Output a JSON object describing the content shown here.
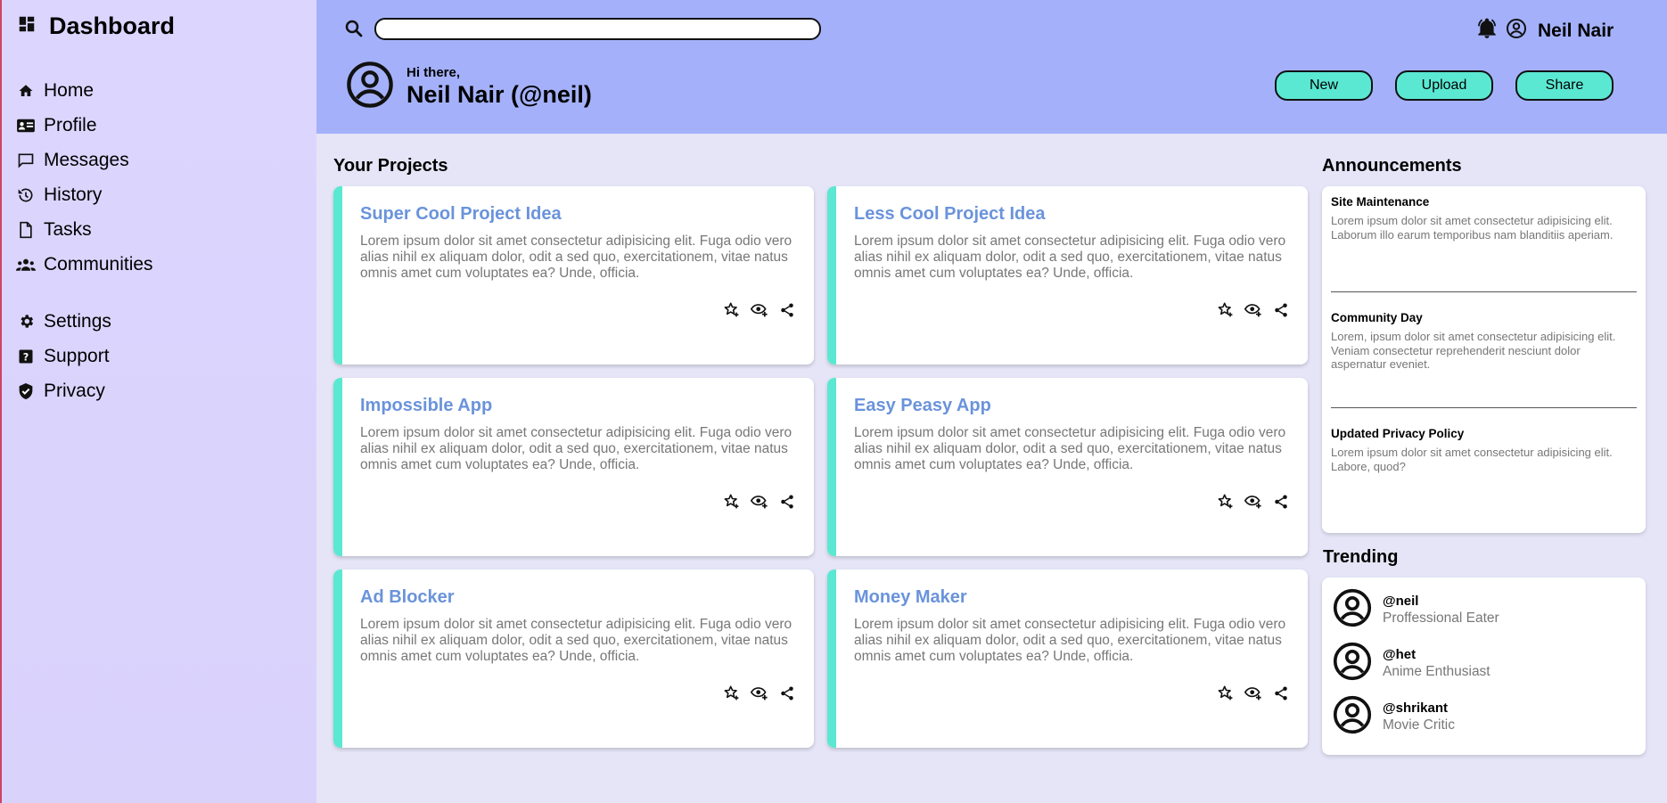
{
  "sidebar": {
    "title": "Dashboard",
    "items": [
      {
        "label": "Home",
        "icon": "home-icon"
      },
      {
        "label": "Profile",
        "icon": "id-card-icon"
      },
      {
        "label": "Messages",
        "icon": "message-icon"
      },
      {
        "label": "History",
        "icon": "history-icon"
      },
      {
        "label": "Tasks",
        "icon": "file-icon"
      },
      {
        "label": "Communities",
        "icon": "group-icon"
      },
      {
        "label": "Settings",
        "icon": "gear-icon"
      },
      {
        "label": "Support",
        "icon": "help-icon"
      },
      {
        "label": "Privacy",
        "icon": "shield-icon"
      }
    ]
  },
  "header": {
    "search_value": "",
    "username": "Neil Nair",
    "greeting": "Hi there,",
    "display_name": "Neil Nair (@neil)",
    "actions": [
      "New",
      "Upload",
      "Share"
    ]
  },
  "projects": {
    "title": "Your Projects",
    "items": [
      {
        "title": "Super Cool Project Idea",
        "desc": "Lorem ipsum dolor sit amet consectetur adipisicing elit. Fuga odio vero alias nihil ex aliquam dolor, odit a sed quo, exercitationem, vitae natus omnis amet cum voluptates ea? Unde, officia."
      },
      {
        "title": "Less Cool Project Idea",
        "desc": "Lorem ipsum dolor sit amet consectetur adipisicing elit. Fuga odio vero alias nihil ex aliquam dolor, odit a sed quo, exercitationem, vitae natus omnis amet cum voluptates ea? Unde, officia."
      },
      {
        "title": "Impossible App",
        "desc": "Lorem ipsum dolor sit amet consectetur adipisicing elit. Fuga odio vero alias nihil ex aliquam dolor, odit a sed quo, exercitationem, vitae natus omnis amet cum voluptates ea? Unde, officia."
      },
      {
        "title": "Easy Peasy App",
        "desc": "Lorem ipsum dolor sit amet consectetur adipisicing elit. Fuga odio vero alias nihil ex aliquam dolor, odit a sed quo, exercitationem, vitae natus omnis amet cum voluptates ea? Unde, officia."
      },
      {
        "title": "Ad Blocker",
        "desc": "Lorem ipsum dolor sit amet consectetur adipisicing elit. Fuga odio vero alias nihil ex aliquam dolor, odit a sed quo, exercitationem, vitae natus omnis amet cum voluptates ea? Unde, officia."
      },
      {
        "title": "Money Maker",
        "desc": "Lorem ipsum dolor sit amet consectetur adipisicing elit. Fuga odio vero alias nihil ex aliquam dolor, odit a sed quo, exercitationem, vitae natus omnis amet cum voluptates ea? Unde, officia."
      }
    ]
  },
  "announcements": {
    "title": "Announcements",
    "items": [
      {
        "title": "Site Maintenance",
        "body": "Lorem ipsum dolor sit amet consectetur adipisicing elit. Laborum illo earum temporibus nam blanditiis aperiam."
      },
      {
        "title": "Community Day",
        "body": "Lorem, ipsum dolor sit amet consectetur adipisicing elit. Veniam consectetur reprehenderit nesciunt dolor aspernatur eveniet."
      },
      {
        "title": "Updated Privacy Policy",
        "body": "Lorem ipsum dolor sit amet consectetur adipisicing elit. Labore, quod?"
      }
    ]
  },
  "trending": {
    "title": "Trending",
    "items": [
      {
        "handle": "@neil",
        "role": "Proffessional Eater"
      },
      {
        "handle": "@het",
        "role": "Anime Enthusiast"
      },
      {
        "handle": "@shrikant",
        "role": "Movie Critic"
      }
    ]
  },
  "colors": {
    "sidebar_bg": "#dcd6ff",
    "header_bg": "#a4b1fa",
    "page_bg": "#e5e5f7",
    "accent": "#5be8d2",
    "card_title": "#6a93db"
  }
}
